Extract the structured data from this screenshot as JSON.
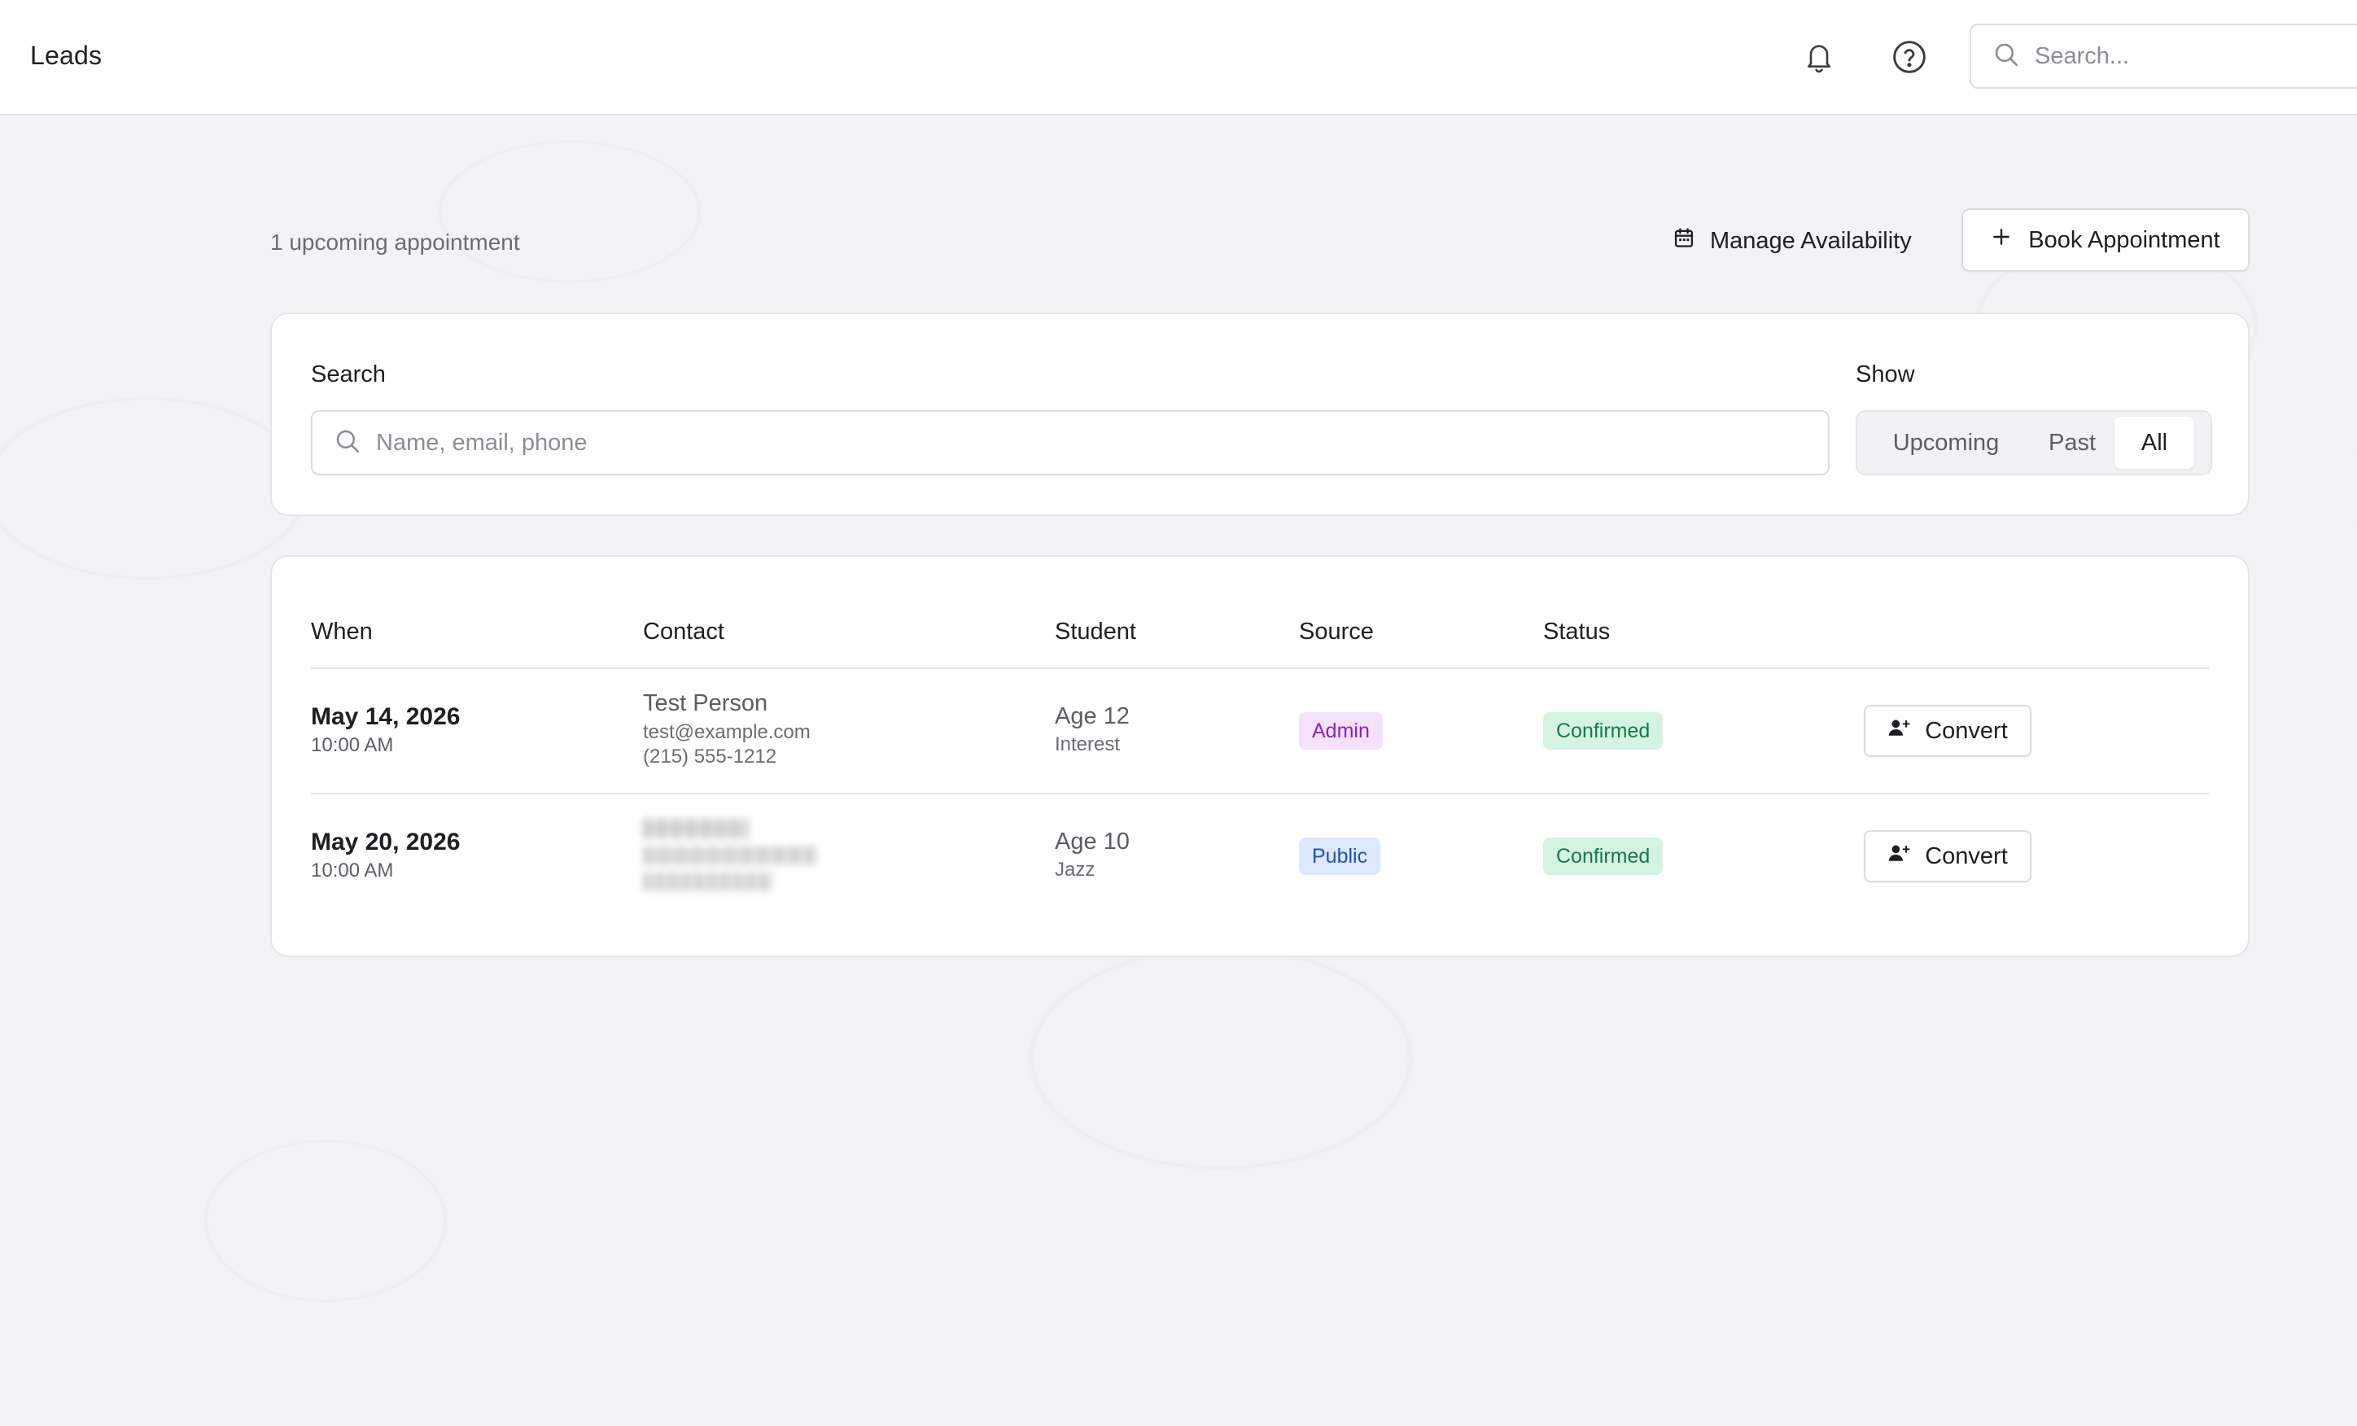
{
  "header": {
    "title": "Leads",
    "search_placeholder": "Search..."
  },
  "toolbar": {
    "count_text": "1 upcoming appointment",
    "manage_label": "Manage Availability",
    "book_label": "Book Appointment"
  },
  "filters": {
    "search_label": "Search",
    "search_placeholder": "Name, email, phone",
    "show_label": "Show",
    "options": [
      "Upcoming",
      "Past",
      "All"
    ],
    "selected": "All"
  },
  "table": {
    "columns": [
      "When",
      "Contact",
      "Student",
      "Source",
      "Status"
    ],
    "rows": [
      {
        "date": "May 14, 2026",
        "time": "10:00 AM",
        "contact_name": "Test Person",
        "contact_email": "test@example.com",
        "contact_phone": "(215) 555-1212",
        "age": "Age 12",
        "interest": "Interest",
        "source": "Admin",
        "status": "Confirmed",
        "action": "Convert"
      },
      {
        "date": "May 20, 2026",
        "time": "10:00 AM",
        "contact_name": "",
        "contact_email": "",
        "contact_phone": "",
        "age": "Age 10",
        "interest": "Jazz",
        "source": "Public",
        "status": "Confirmed",
        "action": "Convert"
      }
    ]
  },
  "colors": {
    "admin_bg": "#f5e1fb",
    "admin_fg": "#8a23b8",
    "public_bg": "#dce9fb",
    "public_fg": "#2350b0",
    "confirmed_bg": "#d4f4e2",
    "confirmed_fg": "#177a45"
  }
}
